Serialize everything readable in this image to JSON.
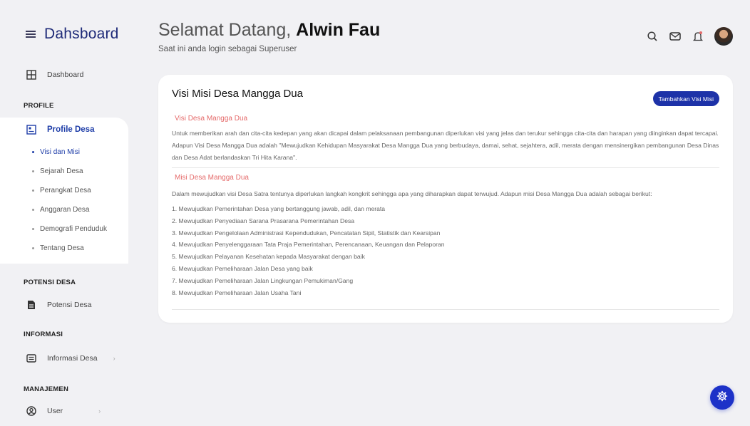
{
  "sidebar": {
    "brand": "Dahsboard",
    "dashboard_label": "Dashboard",
    "section_profile": "PROFILE",
    "profile_desa": "Profile Desa",
    "sub_items": [
      "Visi dan Misi",
      "Sejarah Desa",
      "Perangkat Desa",
      "Anggaran Desa",
      "Demografi Penduduk",
      "Tentang Desa"
    ],
    "section_potensi": "POTENSI DESA",
    "potensi_label": "Potensi Desa",
    "section_informasi": "INFORMASI",
    "informasi_label": "Informasi Desa",
    "section_manajemen": "MANAJEMEN",
    "user_label": "User"
  },
  "header": {
    "greeting": "Selamat Datang,",
    "user_name": "Alwin Fau",
    "subtitle": "Saat ini anda login sebagai Superuser"
  },
  "card": {
    "title": "Visi Misi Desa Mangga Dua",
    "add_button": "Tambahkan Visi Misi",
    "visi_heading": "Visi Desa Mangga Dua",
    "visi_text": "Untuk memberikan arah dan cita-cita kedepan yang akan dicapai dalam pelaksanaan pembangunan diperlukan visi yang jelas dan terukur sehingga cita-cita dan harapan yang diinginkan dapat tercapai. Adapun Visi Desa Mangga Dua adalah \"Mewujudkan Kehidupan Masyarakat Desa Mangga Dua yang berbudaya, damai, sehat, sejahtera, adil, merata dengan mensinergikan pembangunan Desa Dinas dan Desa Adat berlandaskan Tri Hita Karana\".",
    "misi_heading": "Misi Desa Mangga Dua",
    "misi_intro": "Dalam mewujudkan visi Desa Satra tentunya diperlukan langkah kongkrit sehingga apa yang diharapkan dapat terwujud. Adapun misi Desa Mangga Dua adalah sebagai berikut:",
    "misi_items": [
      "1. Mewujudkan Pemerintahan Desa yang bertanggung jawab, adil, dan merata",
      "2. Mewujudkan Penyediaan Sarana Prasarana Pemerintahan Desa",
      "3. Mewujudkan Pengelolaan Administrasi Kependudukan, Pencatatan Sipil, Statistik dan Kearsipan",
      "4. Mewujudkan Penyelenggaraan Tata Praja Pemerintahan, Perencanaan, Keuangan dan Pelaporan",
      "5. Mewujudkan Pelayanan Kesehatan kepada Masyarakat dengan baik",
      "6. Mewujudkan Pemeliharaan Jalan Desa yang baik",
      "7. Mewujudkan Pemeliharaan Jalan Lingkungan Pemukiman/Gang",
      "8. Mewujudkan Pemeliharaan Jalan Usaha Tani"
    ]
  },
  "colors": {
    "primary": "#1d32a8",
    "accent_red": "#e56b6b",
    "background": "#f1f1f4"
  },
  "icons": [
    "menu-icon",
    "grid-icon",
    "profile-desa-icon",
    "document-icon",
    "info-box-icon",
    "user-circle-icon",
    "search-icon",
    "mail-icon",
    "bell-icon",
    "settings-gear-icon"
  ]
}
